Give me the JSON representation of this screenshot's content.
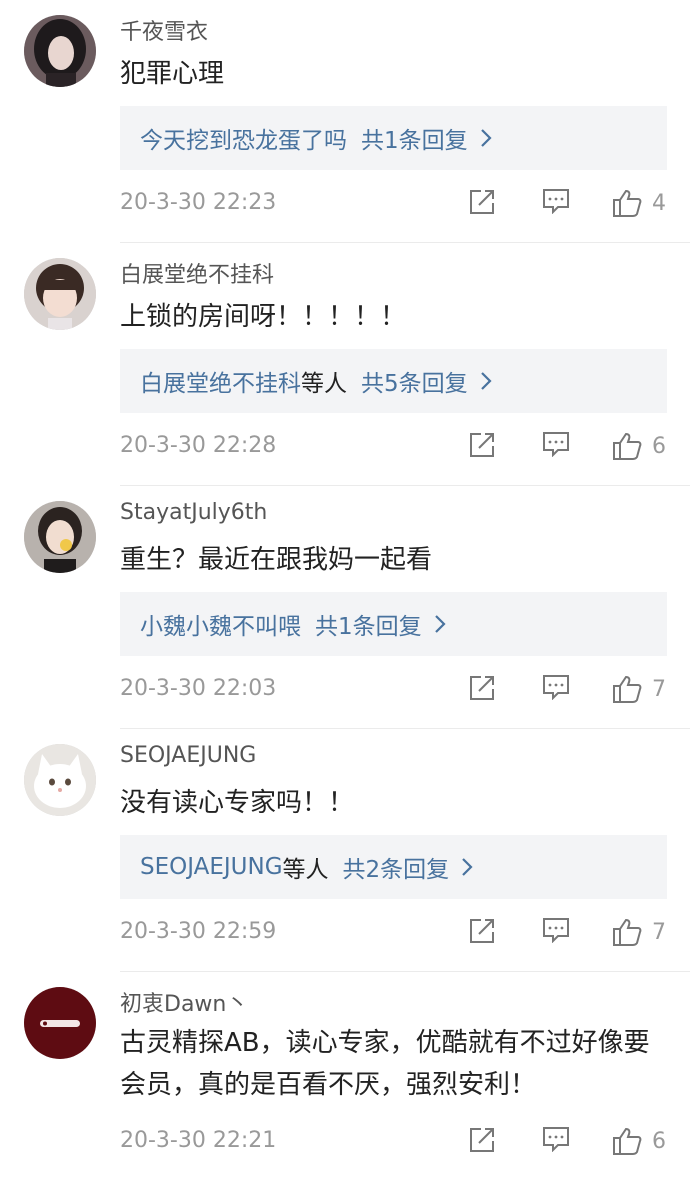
{
  "comments": [
    {
      "username": "千夜雪衣",
      "text": "犯罪心理",
      "reply": {
        "names": "今天挖到恐龙蛋了吗",
        "suffix": "",
        "count": "共1条回复"
      },
      "time": "20-3-30 22:23",
      "likes": "4",
      "avatar_icon": "avatar-dark-hair-girl"
    },
    {
      "username": "白展堂绝不挂科",
      "text": "上锁的房间呀！！！！！",
      "reply": {
        "names": "白展堂绝不挂科",
        "suffix": "等人",
        "count": "共5条回复"
      },
      "time": "20-3-30 22:28",
      "likes": "6",
      "avatar_icon": "avatar-little-girl"
    },
    {
      "username": "StayatJuly6th",
      "text": "重生？最近在跟我妈一起看",
      "reply": {
        "names": "小魏小魏不叫喂",
        "suffix": "",
        "count": "共1条回复"
      },
      "time": "20-3-30 22:03",
      "likes": "7",
      "avatar_icon": "avatar-girl-selfie"
    },
    {
      "username": "SEOJAEJUNG",
      "text": "没有读心专家吗！！",
      "reply": {
        "names": "SEOJAEJUNG",
        "suffix": "等人",
        "count": "共2条回复"
      },
      "time": "20-3-30 22:59",
      "likes": "7",
      "avatar_icon": "avatar-white-cat"
    },
    {
      "username": "初衷Dawn丶",
      "text": "古灵精探AB，读心专家，优酷就有不过好像要会员，真的是百看不厌，强烈安利！",
      "reply": null,
      "time": "20-3-30 22:21",
      "likes": "6",
      "avatar_icon": "avatar-dark-red-logo"
    }
  ],
  "colors": {
    "link": "#48729e",
    "reply_bg": "#f3f4f6",
    "meta": "#999999",
    "divider": "#ebebeb"
  },
  "icons": {
    "share": "share-icon",
    "comment": "comment-icon",
    "like": "thumbs-up-icon",
    "chevron": "chevron-right-icon"
  }
}
